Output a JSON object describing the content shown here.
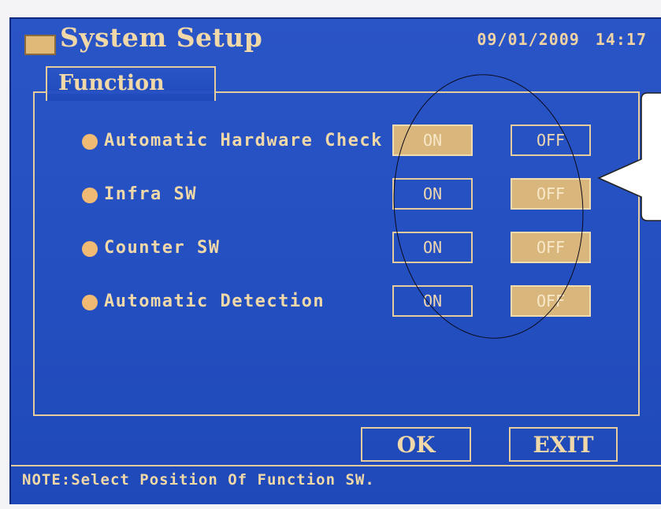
{
  "header": {
    "title": "System Setup",
    "date": "09/01/2009",
    "time": "14:17"
  },
  "tab": {
    "label": "Function"
  },
  "functions": [
    {
      "label": "Automatic Hardware Check",
      "on_label": "ON",
      "off_label": "OFF",
      "selected": "ON"
    },
    {
      "label": "Infra SW",
      "on_label": "ON",
      "off_label": "OFF",
      "selected": "OFF"
    },
    {
      "label": "Counter SW",
      "on_label": "ON",
      "off_label": "OFF",
      "selected": "OFF"
    },
    {
      "label": "Automatic Detection",
      "on_label": "ON",
      "off_label": "OFF",
      "selected": "OFF"
    }
  ],
  "buttons": {
    "ok": "OK",
    "exit": "EXIT"
  },
  "note": "NOTE:Select Position Of Function SW.",
  "colors": {
    "screen_blue": "#2450c2",
    "accent_tan": "#e6cc9c",
    "selected_fill": "#d8b67c",
    "bullet": "#f0ba74"
  }
}
